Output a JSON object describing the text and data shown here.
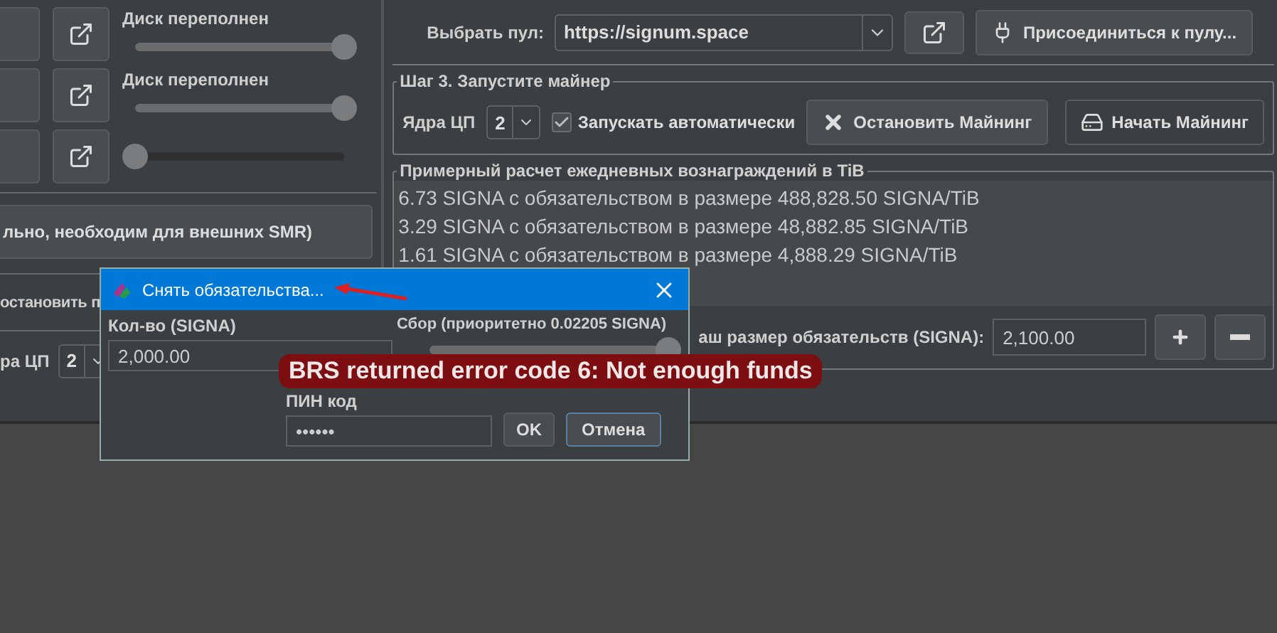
{
  "left_panel": {
    "drives": [
      {
        "status": "Диск переполнен",
        "level": 1
      },
      {
        "status": "Диск переполнен",
        "level": 1
      },
      {
        "level": 0
      }
    ],
    "wide_button": "льно, необходим для внешних SMR)",
    "option_label": "остановить п",
    "cores": {
      "label": "ра ЦП",
      "value": "2"
    }
  },
  "pool": {
    "label": "Выбрать пул:",
    "value": "https://signum.space",
    "join_button": "Присоединиться к пулу..."
  },
  "step3": {
    "title": "Шаг 3. Запустите майнер",
    "cores_label": "Ядра ЦП",
    "cores_value": "2",
    "autostart": {
      "label": "Запускать автоматически",
      "checked": true
    },
    "stop_button": "Остановить Майнинг",
    "start_button": "Начать Майнинг"
  },
  "rewards": {
    "title": "Примерный расчет ежедневных вознаграждений в TiB",
    "lines": [
      "6.73 SIGNA с обязательством в размере 488,828.50 SIGNA/TiB",
      "3.29 SIGNA с обязательством в размере 48,882.85 SIGNA/TiB",
      "1.61 SIGNA с обязательством в размере 4,888.29 SIGNA/TiB"
    ],
    "commitment": {
      "label": "аш размер обязательств (SIGNA):",
      "value": "2,100.00"
    }
  },
  "dialog": {
    "title": "Снять обязательства...",
    "amount": {
      "label": "Кол-во (SIGNA)",
      "value": "2,000.00"
    },
    "fee": {
      "label": "Сбор (приоритетно 0.02205 SIGNA)",
      "level": 1
    },
    "pin": {
      "label": "ПИН код",
      "value": "••••••"
    },
    "buttons": [
      "OK",
      "Отмена"
    ]
  },
  "toast": {
    "message": "BRS returned error code 6: Not enough funds"
  }
}
